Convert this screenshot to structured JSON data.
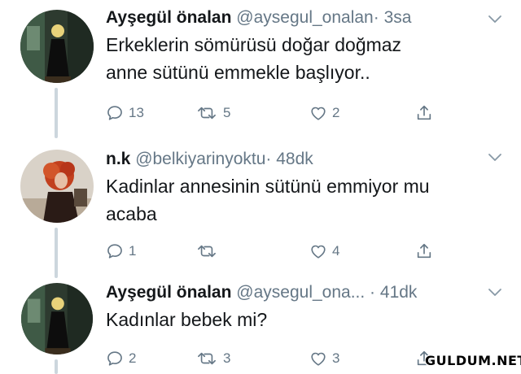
{
  "colors": {
    "text": "#14171a",
    "secondary": "#657786",
    "thread_line": "#ccd6dd",
    "background": "#ffffff"
  },
  "tweets": [
    {
      "name": "Ayşegül önalan",
      "handle": "@aysegul_onalan",
      "separator": "·",
      "time": "3sa",
      "text_lines": [
        "Erkeklerin sömürüsü doğar doğmaz",
        "anne sütünü emmekle başlıyor.."
      ],
      "reply_count": "13",
      "retweet_count": "5",
      "like_count": "2",
      "icons": [
        "reply-icon",
        "retweet-icon",
        "like-icon",
        "share-icon",
        "chevron-down-icon"
      ]
    },
    {
      "name": "n.k",
      "handle": "@belkiyarinyoktu",
      "separator": "·",
      "time": "48dk",
      "text_lines": [
        "Kadinlar annesinin sütünü emmiyor mu",
        "acaba"
      ],
      "reply_count": "1",
      "retweet_count": "",
      "like_count": "4",
      "icons": [
        "reply-icon",
        "retweet-icon",
        "like-icon",
        "share-icon",
        "chevron-down-icon"
      ]
    },
    {
      "name": "Ayşegül önalan",
      "handle": "@aysegul_ona...",
      "separator": "·",
      "time": "41dk",
      "text_lines": [
        "Kadınlar bebek mi?"
      ],
      "reply_count": "2",
      "retweet_count": "3",
      "like_count": "3",
      "icons": [
        "reply-icon",
        "retweet-icon",
        "like-icon",
        "share-icon",
        "chevron-down-icon"
      ]
    }
  ],
  "watermark": "GULDUM.NET"
}
